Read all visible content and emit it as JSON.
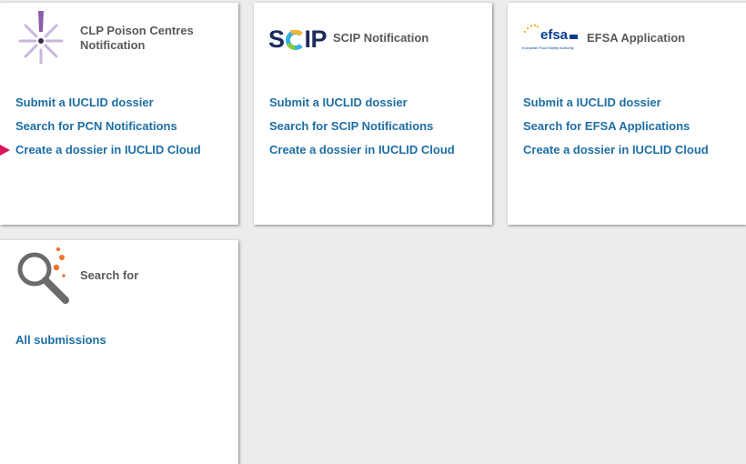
{
  "cards": {
    "clp": {
      "title_line1": "CLP Poison Centres",
      "title_line2": "Notification",
      "icon": "exclamation-burst-icon",
      "links": [
        "Submit a IUCLID dossier",
        "Search for PCN Notifications",
        "Create a dossier in IUCLID Cloud"
      ]
    },
    "scip": {
      "logo_text": "SCIP",
      "title": "SCIP Notification",
      "links": [
        "Submit a IUCLID dossier",
        "Search for SCIP Notifications",
        "Create a dossier in IUCLID Cloud"
      ]
    },
    "efsa": {
      "logo_text": "efsa",
      "logo_subtext": "European Food Safety Authority",
      "title": "EFSA Application",
      "links": [
        "Submit a IUCLID dossier",
        "Search for EFSA Applications",
        "Create a dossier in IUCLID Cloud"
      ]
    },
    "search": {
      "title": "Search for",
      "icon": "magnifier-icon",
      "links": [
        "All submissions"
      ]
    }
  },
  "colors": {
    "link": "#1d6ea5",
    "title": "#595959",
    "pointer": "#d9145a",
    "clp_purple": "#8a5ea8",
    "scip_navy": "#1c2c5b",
    "efsa_blue": "#0a3d91",
    "search_orange": "#e8772e"
  }
}
